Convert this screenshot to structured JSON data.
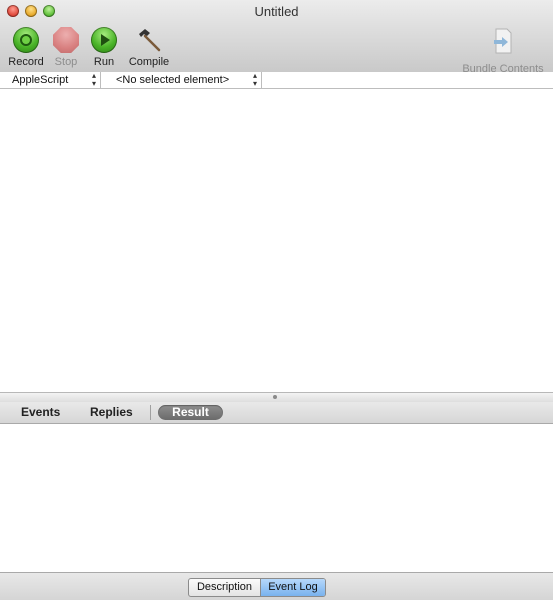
{
  "window": {
    "title": "Untitled"
  },
  "toolbar": {
    "record_label": "Record",
    "stop_label": "Stop",
    "run_label": "Run",
    "compile_label": "Compile",
    "bundle_label": "Bundle Contents"
  },
  "navbar": {
    "language": "AppleScript",
    "element": "<No selected element>"
  },
  "editor": {
    "content": ""
  },
  "log_tabs": {
    "events": "Events",
    "replies": "Replies",
    "result": "Result",
    "selected": "Result"
  },
  "bottom": {
    "description": "Description",
    "event_log": "Event Log",
    "selected": "Event Log"
  },
  "colors": {
    "accent_selected": "#79b2ee",
    "record_green": "#49b327",
    "stop_red": "#d96363"
  }
}
